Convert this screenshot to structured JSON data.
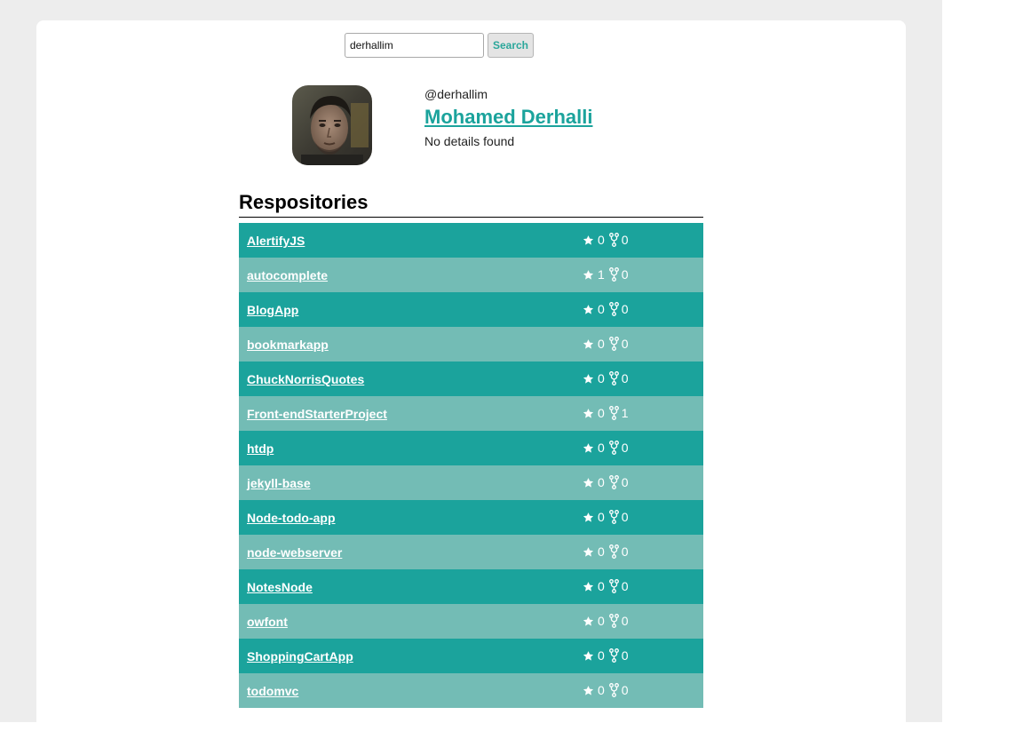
{
  "search": {
    "value": "derhallim",
    "button_label": "Search"
  },
  "profile": {
    "handle": "@derhallim",
    "name": "Mohamed Derhalli",
    "details": "No details found",
    "avatar_icon": "user-avatar-photo"
  },
  "repos": {
    "heading": "Respositories",
    "items": [
      {
        "name": "AlertifyJS",
        "stars": "0",
        "forks": "0"
      },
      {
        "name": "autocomplete",
        "stars": "1",
        "forks": "0"
      },
      {
        "name": "BlogApp",
        "stars": "0",
        "forks": "0"
      },
      {
        "name": "bookmarkapp",
        "stars": "0",
        "forks": "0"
      },
      {
        "name": "ChuckNorrisQuotes",
        "stars": "0",
        "forks": "0"
      },
      {
        "name": "Front-endStarterProject",
        "stars": "0",
        "forks": "1"
      },
      {
        "name": "htdp",
        "stars": "0",
        "forks": "0"
      },
      {
        "name": "jekyll-base",
        "stars": "0",
        "forks": "0"
      },
      {
        "name": "Node-todo-app",
        "stars": "0",
        "forks": "0"
      },
      {
        "name": "node-webserver",
        "stars": "0",
        "forks": "0"
      },
      {
        "name": "NotesNode",
        "stars": "0",
        "forks": "0"
      },
      {
        "name": "owfont",
        "stars": "0",
        "forks": "0"
      },
      {
        "name": "ShoppingCartApp",
        "stars": "0",
        "forks": "0"
      },
      {
        "name": "todomvc",
        "stars": "0",
        "forks": "0"
      }
    ]
  },
  "colors": {
    "accent": "#1ba39c",
    "row_dark": "#1ba39c",
    "row_light": "#73bcb5",
    "page_bg": "#ededed"
  }
}
